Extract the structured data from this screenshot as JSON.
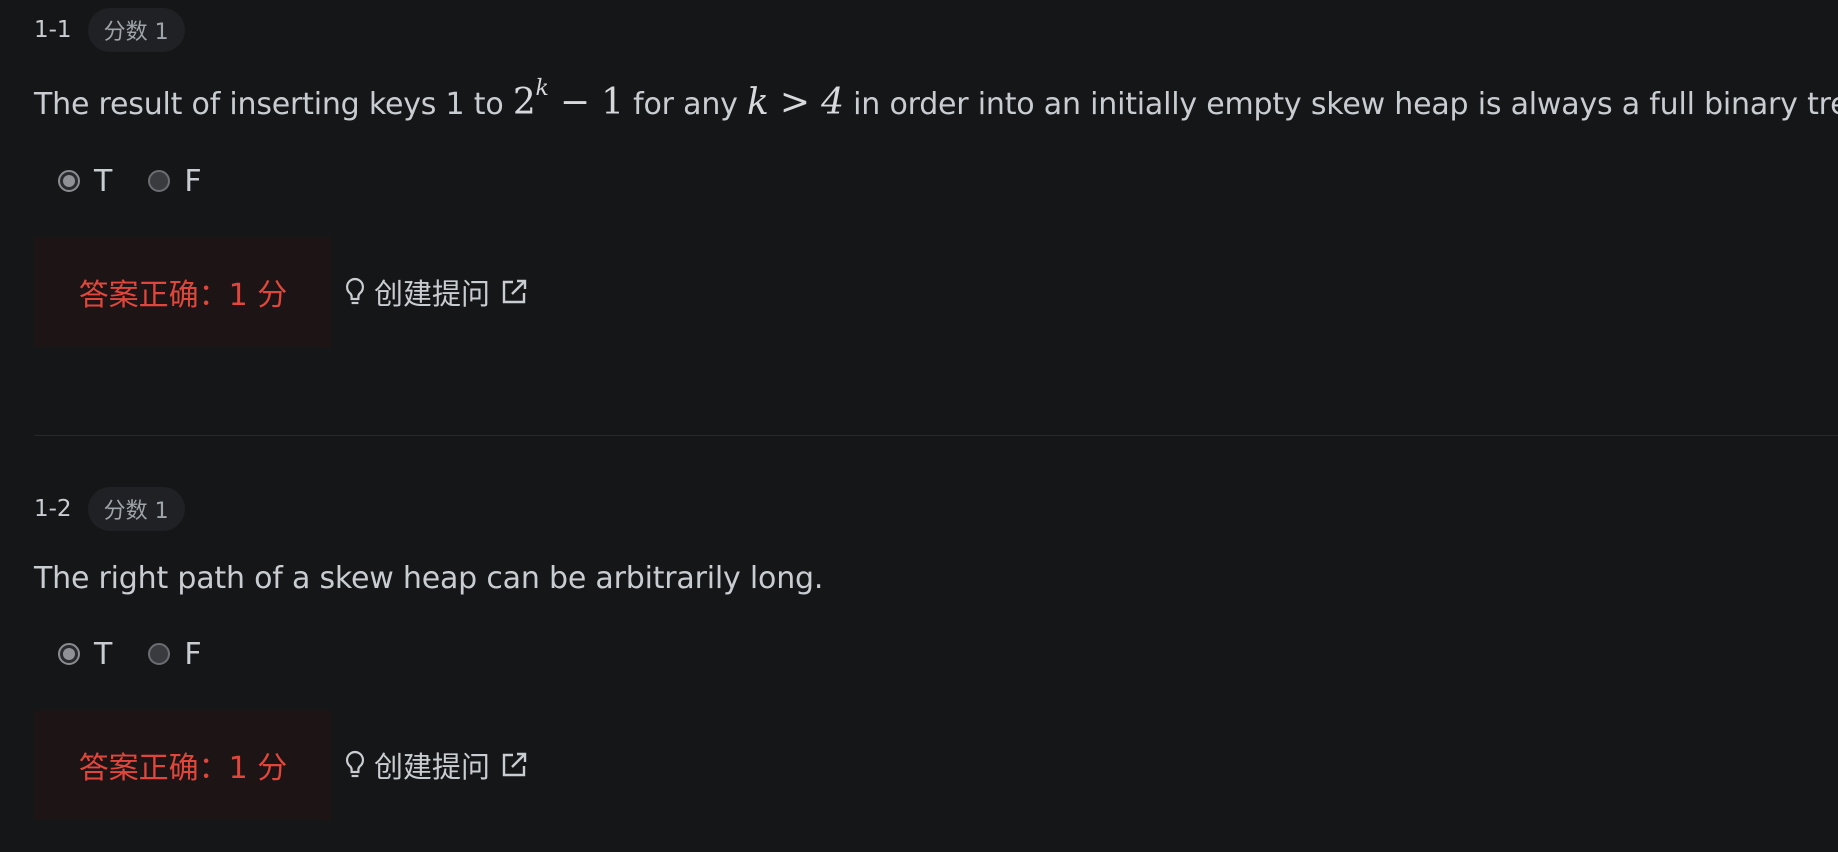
{
  "questions": [
    {
      "id": "1-1",
      "score_badge": "分数 1",
      "text_parts": {
        "a": "The result of inserting keys 1 to ",
        "math1_base": "2",
        "math1_sup": "k",
        "math1_rest": " − 1",
        "b": " for any ",
        "math2": "k > 4",
        "c": " in order into an initially empty skew heap is always a full binary tree."
      },
      "options": [
        {
          "label": "T",
          "checked": true
        },
        {
          "label": "F",
          "checked": false
        }
      ],
      "result": "答案正确：1 分",
      "ask_label": "创建提问"
    },
    {
      "id": "1-2",
      "score_badge": "分数 1",
      "text": "The right path of a skew heap can be arbitrarily long.",
      "options": [
        {
          "label": "T",
          "checked": true
        },
        {
          "label": "F",
          "checked": false
        }
      ],
      "result": "答案正确：1 分",
      "ask_label": "创建提问"
    }
  ],
  "colors": {
    "background": "#151618",
    "text": "#c9ccd1",
    "correct": "#e0463c",
    "result_bg": "#1c1415"
  },
  "icons": [
    "lightbulb-icon",
    "external-link-icon"
  ]
}
